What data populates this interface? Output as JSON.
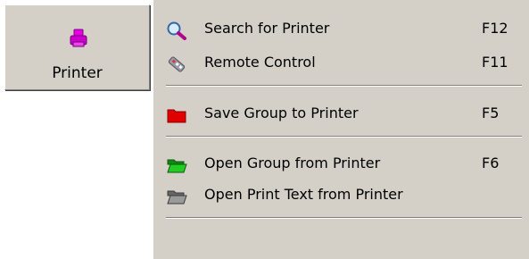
{
  "printer_button": {
    "label": "Printer",
    "icon": "printer-icon",
    "icon_color": "#cc00cc"
  },
  "menu": {
    "items": [
      {
        "label": "Search for Printer",
        "shortcut": "F12",
        "icon": "magnifier-icon"
      },
      {
        "label": "Remote Control",
        "shortcut": "F11",
        "icon": "remote-control-icon"
      },
      {
        "label": "Save Group to Printer",
        "shortcut": "F5",
        "icon": "red-folder-icon",
        "icon_color": "#e00000"
      },
      {
        "label": "Open Group from Printer",
        "shortcut": "F6",
        "icon": "green-folder-icon",
        "icon_color": "#22bb22"
      },
      {
        "label": "Open Print Text from Printer",
        "shortcut": "",
        "icon": "gray-folder-icon",
        "icon_color": "#8a8a8a"
      }
    ]
  }
}
